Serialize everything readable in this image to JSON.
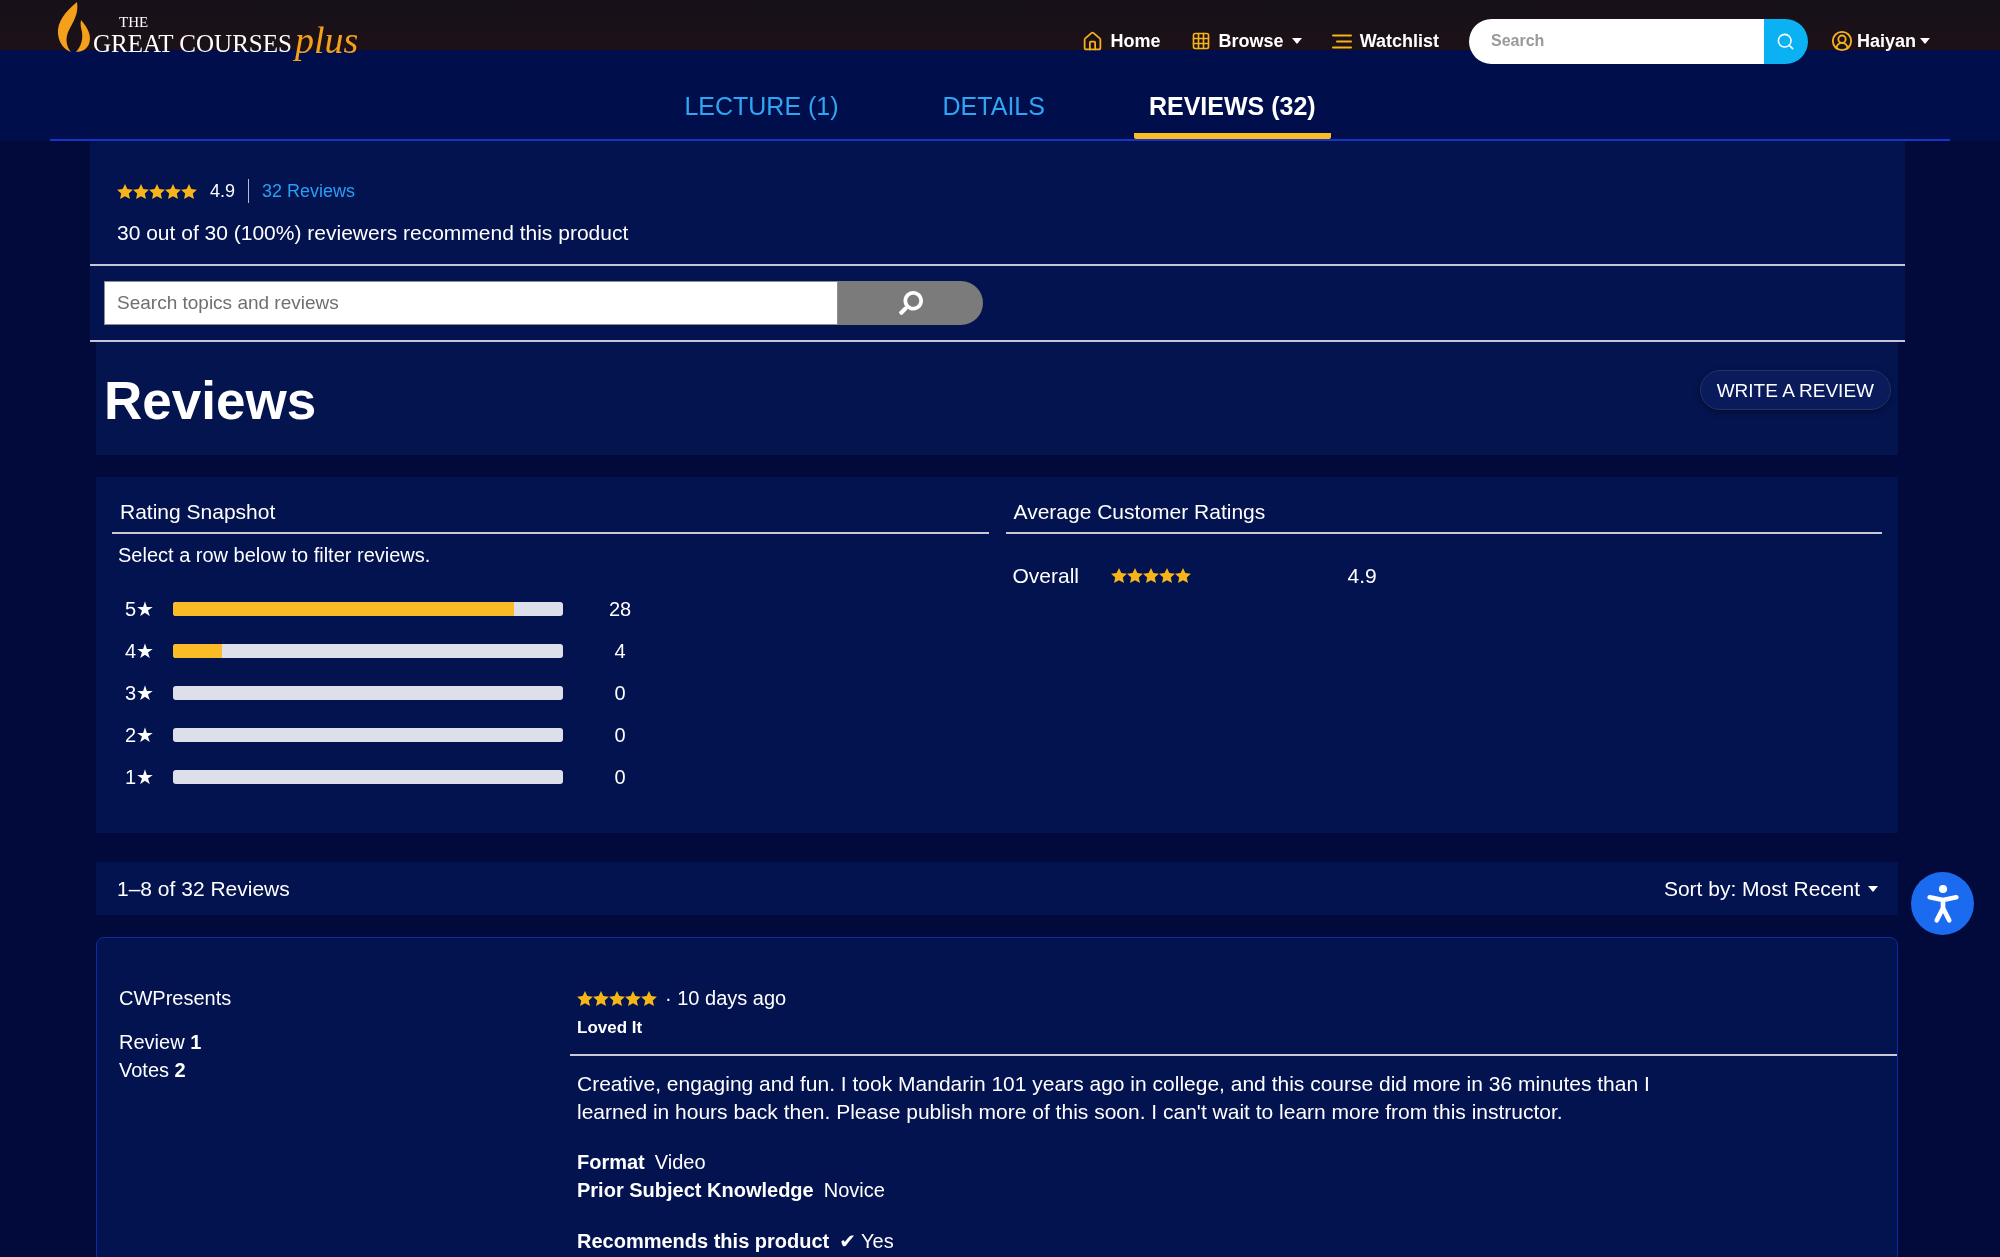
{
  "header": {
    "logo": {
      "top": "THE",
      "name": "GREAT COURSES",
      "suffix": "plus"
    },
    "nav": [
      {
        "kind": "home",
        "label": "Home",
        "has_caret": false
      },
      {
        "kind": "grid",
        "label": "Browse",
        "has_caret": true
      },
      {
        "kind": "list",
        "label": "Watchlist",
        "has_caret": false
      }
    ],
    "search": {
      "placeholder": "Search"
    },
    "user": {
      "label": "Haiyan",
      "has_caret": true
    }
  },
  "tabs": [
    {
      "label": "LECTURE (1)",
      "selected": false
    },
    {
      "label": "DETAILS",
      "selected": false
    },
    {
      "label": "REVIEWS (32)",
      "selected": true
    }
  ],
  "summary": {
    "stars": 5,
    "rating": "4.9",
    "reviews_link": "32 Reviews",
    "recommend_text": "30 out of 30 (100%) reviewers recommend this product"
  },
  "review_search": {
    "placeholder": "Search topics and reviews"
  },
  "reviews_header": {
    "title": "Reviews",
    "write_button": "WRITE A REVIEW"
  },
  "rating_snapshot": {
    "title": "Rating Snapshot",
    "hint": "Select a row below to filter reviews.",
    "rows": [
      {
        "label": "5★",
        "level": 0.875,
        "count": "28"
      },
      {
        "label": "4★",
        "level": 0.125,
        "count": "4"
      },
      {
        "label": "3★",
        "level": 0,
        "count": "0"
      },
      {
        "label": "2★",
        "level": 0,
        "count": "0"
      },
      {
        "label": "1★",
        "level": 0,
        "count": "0"
      }
    ]
  },
  "average_ratings": {
    "title": "Average Customer Ratings",
    "rows": [
      {
        "label": "Overall",
        "stars": 5,
        "rating": "4.9"
      }
    ]
  },
  "results_bar": {
    "count": "1–8 of 32 Reviews",
    "sort": "Sort by: Most Recent"
  },
  "reviews": [
    {
      "author": "CWPresents",
      "stats": [
        "Review **1**",
        "Votes **2**"
      ],
      "stars": 5,
      "date": "· 10 days ago",
      "title": "Loved It",
      "body": "Creative, engaging and fun. I took Mandarin 101 years ago in college, and this course did more in 36 minutes than I learned in hours back then. Please publish more of this soon. I can't wait to learn more from this instructor.",
      "details": [
        {
          "label": "Format",
          "value": "Video"
        },
        {
          "label": "Prior Subject Knowledge",
          "value": "Novice"
        }
      ],
      "recommends": {
        "label": "Recommends this product",
        "check": "✔",
        "value": "Yes"
      }
    }
  ]
}
